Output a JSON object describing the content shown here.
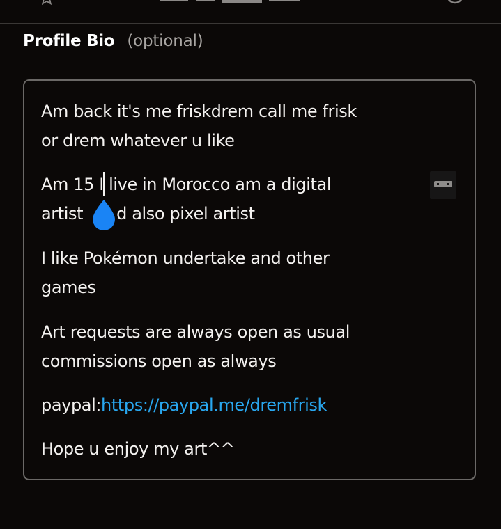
{
  "header": {
    "title": "Profile Bio",
    "optional_label": "(optional)"
  },
  "bio": {
    "lines": [
      "Am back it's me friskdrem call me frisk",
      "or drem whatever u like",
      "Am 15 I live in Morocco am a digital",
      "artist",
      "d also pixel artist",
      "I like Pokémon undertake and other",
      "games",
      "Art requests are always open as usual",
      "commissions open as always",
      "paypal:",
      "https://paypal.me/dremfrisk",
      "Hope u enjoy my art^^"
    ]
  },
  "colors": {
    "background": "#0b0807",
    "text": "#f4f2f0",
    "muted": "#a8a5a2",
    "border": "#6b6866",
    "link": "#29a7ef",
    "cursor_handle": "#1a84f5"
  },
  "icons": {
    "top_left": "star-icon",
    "top_right": "circle-icon",
    "cursor": "text-cursor-handle",
    "keyboard": "keyboard-icon"
  }
}
